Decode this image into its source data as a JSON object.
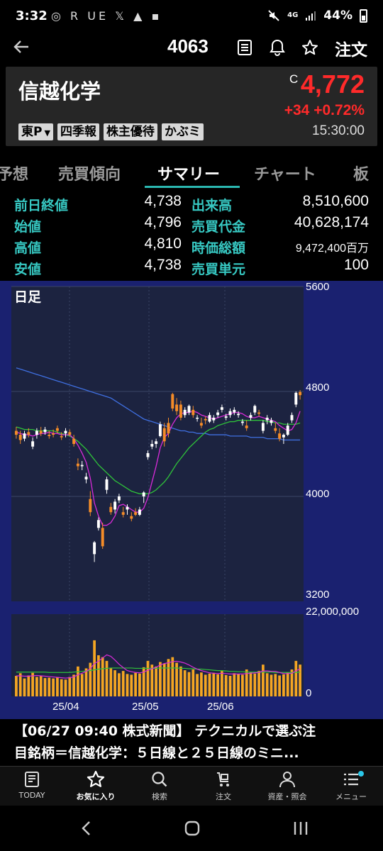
{
  "status_bar": {
    "time": "3:32",
    "icons_left": "◎ R UE 𝕏 ▲ ▪",
    "battery": "44%",
    "network": "4G"
  },
  "header": {
    "code": "4063",
    "order_label": "注文"
  },
  "stock": {
    "name": "信越化学",
    "price_flag": "C",
    "price": "4,772",
    "change": "+34 +0.72%",
    "time": "15:30:00",
    "tags": [
      "東P",
      "四季報",
      "株主優待",
      "かぶミ"
    ],
    "price_color": "#ff2a2a"
  },
  "tabs": [
    "予想",
    "売買傾向",
    "サマリー",
    "チャート",
    "板"
  ],
  "active_tab": "サマリー",
  "summary": {
    "left": [
      {
        "label": "前日終値",
        "value": "4,738"
      },
      {
        "label": "始値",
        "value": "4,796"
      },
      {
        "label": "高値",
        "value": "4,810"
      },
      {
        "label": "安値",
        "value": "4,738"
      }
    ],
    "right": [
      {
        "label": "出来高",
        "value": "8,510,600"
      },
      {
        "label": "売買代金",
        "value": "40,628,174"
      },
      {
        "label": "時価総額",
        "value": "9,472,400百万"
      },
      {
        "label": "売買単元",
        "value": "100"
      }
    ]
  },
  "chart": {
    "period_label": "日足",
    "y_ticks": [
      "5600",
      "4800",
      "4000",
      "3200"
    ],
    "vol_ticks": [
      "22,000,000",
      "0"
    ],
    "x_ticks": [
      "25/04",
      "25/05",
      "25/06"
    ]
  },
  "chart_data": {
    "type": "candlestick",
    "ylim": [
      3200,
      5600
    ],
    "volume_ylim": [
      0,
      22000000
    ],
    "x": [
      "25/04",
      "25/05",
      "25/06"
    ],
    "series": [
      {
        "values": [
          [
            4500,
            4530,
            4440,
            4470
          ],
          [
            4470,
            4500,
            4400,
            4430
          ],
          [
            4440,
            4500,
            4420,
            4480
          ],
          [
            4490,
            4520,
            4450,
            4470
          ],
          [
            4380,
            4450,
            4360,
            4420
          ],
          [
            4470,
            4520,
            4440,
            4500
          ],
          [
            4500,
            4530,
            4460,
            4480
          ],
          [
            4490,
            4530,
            4470,
            4510
          ],
          [
            4470,
            4500,
            4440,
            4460
          ],
          [
            4480,
            4510,
            4450,
            4470
          ],
          [
            4520,
            4540,
            4480,
            4500
          ],
          [
            4460,
            4490,
            4430,
            4450
          ],
          [
            4480,
            4520,
            4450,
            4500
          ],
          [
            4490,
            4510,
            4460,
            4470
          ],
          [
            4440,
            4470,
            4380,
            4400
          ],
          [
            4250,
            4290,
            4200,
            4230
          ],
          [
            4230,
            4270,
            4200,
            4240
          ],
          [
            4130,
            4180,
            4100,
            4150
          ],
          [
            3980,
            4040,
            3850,
            3880
          ],
          [
            3560,
            3660,
            3500,
            3650
          ],
          [
            3760,
            3840,
            3740,
            3820
          ],
          [
            3760,
            3800,
            3600,
            3620
          ],
          [
            4050,
            4150,
            4020,
            4130
          ],
          [
            3920,
            3950,
            3860,
            3880
          ],
          [
            3900,
            3980,
            3870,
            3960
          ],
          [
            3970,
            4020,
            3950,
            4000
          ],
          [
            3880,
            3920,
            3840,
            3860
          ],
          [
            3900,
            3940,
            3860,
            3920
          ],
          [
            3850,
            3880,
            3810,
            3830
          ],
          [
            3880,
            3910,
            3850,
            3860
          ],
          [
            3860,
            3920,
            3850,
            3900
          ],
          [
            4000,
            4040,
            3950,
            4030
          ],
          [
            4300,
            4350,
            4280,
            4330
          ],
          [
            4380,
            4430,
            4360,
            4400
          ],
          [
            4400,
            4440,
            4370,
            4420
          ],
          [
            4460,
            4570,
            4450,
            4550
          ],
          [
            4520,
            4560,
            4380,
            4420
          ],
          [
            4560,
            4600,
            4450,
            4480
          ],
          [
            4780,
            4790,
            4650,
            4670
          ],
          [
            4700,
            4750,
            4620,
            4650
          ],
          [
            4700,
            4730,
            4580,
            4600
          ],
          [
            4620,
            4680,
            4600,
            4660
          ],
          [
            4640,
            4700,
            4620,
            4690
          ],
          [
            4660,
            4690,
            4600,
            4620
          ],
          [
            4600,
            4620,
            4570,
            4600
          ],
          [
            4560,
            4600,
            4520,
            4540
          ],
          [
            4590,
            4610,
            4550,
            4580
          ],
          [
            4570,
            4640,
            4560,
            4620
          ],
          [
            4580,
            4620,
            4560,
            4600
          ],
          [
            4620,
            4660,
            4600,
            4640
          ],
          [
            4660,
            4700,
            4640,
            4680
          ],
          [
            4600,
            4630,
            4580,
            4610
          ],
          [
            4620,
            4670,
            4600,
            4650
          ],
          [
            4640,
            4680,
            4620,
            4660
          ],
          [
            4620,
            4650,
            4600,
            4630
          ],
          [
            4560,
            4590,
            4540,
            4570
          ],
          [
            4540,
            4580,
            4500,
            4520
          ],
          [
            4600,
            4640,
            4580,
            4620
          ],
          [
            4640,
            4700,
            4620,
            4690
          ],
          [
            4640,
            4660,
            4610,
            4630
          ],
          [
            4500,
            4580,
            4480,
            4560
          ],
          [
            4580,
            4620,
            4550,
            4600
          ],
          [
            4560,
            4600,
            4540,
            4580
          ],
          [
            4520,
            4560,
            4480,
            4500
          ],
          [
            4480,
            4520,
            4420,
            4440
          ],
          [
            4450,
            4480,
            4400,
            4470
          ],
          [
            4470,
            4560,
            4460,
            4540
          ],
          [
            4580,
            4640,
            4560,
            4620
          ],
          [
            4700,
            4800,
            4680,
            4790
          ],
          [
            4796,
            4810,
            4738,
            4772
          ]
        ]
      },
      {
        "name": "MA5",
        "values": [
          4490,
          4480,
          4470,
          4470,
          4460,
          4470,
          4480,
          4480,
          4490,
          4480,
          4480,
          4470,
          4470,
          4470,
          4440,
          4390,
          4330,
          4260,
          4140,
          3950,
          3850,
          3780,
          3780,
          3800,
          3850,
          3930,
          3940,
          3920,
          3900,
          3880,
          3880,
          3910,
          3990,
          4110,
          4230,
          4370,
          4450,
          4480,
          4550,
          4600,
          4630,
          4640,
          4640,
          4650,
          4640,
          4620,
          4610,
          4600,
          4590,
          4600,
          4610,
          4620,
          4630,
          4640,
          4640,
          4630,
          4610,
          4600,
          4600,
          4610,
          4600,
          4590,
          4580,
          4570,
          4540,
          4520,
          4500,
          4510,
          4560,
          4650
        ]
      },
      {
        "name": "MA25",
        "values": [
          4530,
          4520,
          4510,
          4510,
          4510,
          4500,
          4500,
          4500,
          4500,
          4500,
          4490,
          4480,
          4470,
          4460,
          4440,
          4420,
          4390,
          4360,
          4320,
          4280,
          4240,
          4210,
          4180,
          4150,
          4120,
          4100,
          4080,
          4060,
          4040,
          4030,
          4020,
          4020,
          4020,
          4030,
          4050,
          4080,
          4110,
          4150,
          4200,
          4250,
          4290,
          4330,
          4370,
          4400,
          4430,
          4460,
          4490,
          4510,
          4520,
          4540,
          4550,
          4560,
          4570,
          4570,
          4580,
          4580,
          4580,
          4580,
          4580,
          4580,
          4580,
          4570,
          4570,
          4560,
          4560,
          4550,
          4550,
          4550,
          4550,
          4560
        ]
      },
      {
        "name": "MA75",
        "values": [
          4980,
          4970,
          4960,
          4950,
          4940,
          4930,
          4920,
          4910,
          4900,
          4890,
          4880,
          4870,
          4860,
          4850,
          4840,
          4830,
          4820,
          4810,
          4800,
          4790,
          4780,
          4770,
          4760,
          4750,
          4730,
          4710,
          4690,
          4670,
          4650,
          4630,
          4610,
          4590,
          4580,
          4570,
          4560,
          4550,
          4540,
          4530,
          4520,
          4510,
          4500,
          4500,
          4490,
          4490,
          4480,
          4480,
          4480,
          4470,
          4470,
          4470,
          4470,
          4470,
          4460,
          4460,
          4460,
          4460,
          4460,
          4450,
          4450,
          4450,
          4450,
          4440,
          4440,
          4440,
          4440,
          4430,
          4430,
          4430,
          4430,
          4430
        ]
      }
    ],
    "volume": [
      5500000,
      6200000,
      4800000,
      5600000,
      6300000,
      5200000,
      5400000,
      4900000,
      5000000,
      4800000,
      5100000,
      4600000,
      4500000,
      5200000,
      5800000,
      8000000,
      6000000,
      7500000,
      9000000,
      15000000,
      11000000,
      10500000,
      9500000,
      7500000,
      7000000,
      6200000,
      6800000,
      6000000,
      5800000,
      6300000,
      6100000,
      7800000,
      9500000,
      8500000,
      8000000,
      9200000,
      8800000,
      10000000,
      10500000,
      9000000,
      8000000,
      7000000,
      6500000,
      7200000,
      6000000,
      6400000,
      5800000,
      6100000,
      6300000,
      5900000,
      6800000,
      5700000,
      5500000,
      6200000,
      6000000,
      5800000,
      7200000,
      6500000,
      6100000,
      6800000,
      8500000,
      6200000,
      5800000,
      6000000,
      5600000,
      5900000,
      6400000,
      7200000,
      9500000,
      8510600
    ],
    "volume_ma": [
      5500000,
      5500000,
      5400000,
      5400000,
      5500000,
      5600000,
      5500000,
      5400000,
      5300000,
      5200000,
      5100000,
      5000000,
      4900000,
      5000000,
      5200000,
      5800000,
      6200000,
      6700000,
      7400000,
      8800000,
      9400000,
      10300000,
      11100000,
      10700000,
      9700000,
      8600000,
      7700000,
      6900000,
      6600000,
      6400000,
      6300000,
      6500000,
      7000000,
      7400000,
      7800000,
      8400000,
      8800000,
      9000000,
      9300000,
      9400000,
      9200000,
      8900000,
      8400000,
      7800000,
      7300000,
      6900000,
      6600000,
      6300000,
      6200000,
      6100000,
      6200000,
      6100000,
      6000000,
      6000000,
      6000000,
      6000000,
      6100000,
      6200000,
      6300000,
      6400000,
      6800000,
      6800000,
      6700000,
      6700000,
      6400000,
      6100000,
      6100000,
      6200000,
      6800000,
      7400000
    ],
    "volume_ma2": [
      6500000,
      6500000,
      6500000,
      6500000,
      6500000,
      6500000,
      6500000,
      6500000,
      6400000,
      6400000,
      6400000,
      6400000,
      6400000,
      6400000,
      6500000,
      6600000,
      6700000,
      6800000,
      6900000,
      7100000,
      7300000,
      7400000,
      7500000,
      7600000,
      7600000,
      7600000,
      7600000,
      7600000,
      7600000,
      7500000,
      7500000,
      7500000,
      7500000,
      7500000,
      7500000,
      7600000,
      7600000,
      7600000,
      7600000,
      7600000,
      7500000,
      7500000,
      7400000,
      7400000,
      7300000,
      7300000,
      7200000,
      7100000,
      7000000,
      6900000,
      6900000,
      6800000,
      6700000,
      6700000,
      6600000,
      6600000,
      6500000,
      6500000,
      6500000,
      6500000,
      6500000,
      6500000,
      6500000,
      6400000,
      6400000,
      6400000,
      6400000,
      6400000,
      6400000,
      6500000
    ],
    "colors": {
      "up": "#ffffff",
      "down": "#f58c28",
      "ma5": "#d92bd9",
      "ma25": "#2fc23a",
      "ma75": "#3f6fe0",
      "volume": "#f5a623",
      "background": "#1c2340"
    }
  },
  "news": {
    "line1": "【06/27 09:40 株式新聞】 テクニカルで選ぶ注",
    "line2": "目銘柄＝信越化学：５日線と２５日線のミニ..."
  },
  "bottom_nav": [
    {
      "label": "TODAY",
      "icon": "news-icon"
    },
    {
      "label": "お気に入り",
      "icon": "star-icon"
    },
    {
      "label": "検索",
      "icon": "search-icon"
    },
    {
      "label": "注文",
      "icon": "cart-icon"
    },
    {
      "label": "資産・照会",
      "icon": "person-icon"
    },
    {
      "label": "メニュー",
      "icon": "menu-icon"
    }
  ]
}
